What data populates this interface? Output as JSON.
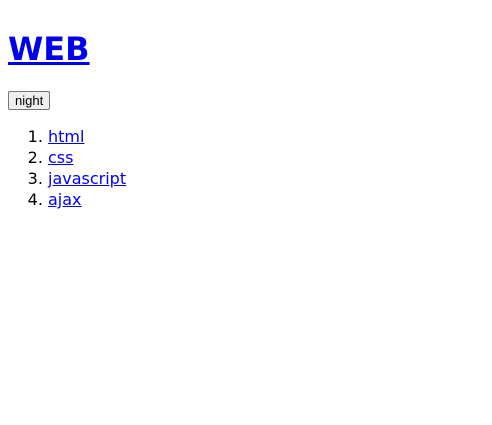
{
  "page": {
    "title": "WEB"
  },
  "toolbar": {
    "night_label": "night"
  },
  "nav": {
    "items": [
      {
        "label": "html"
      },
      {
        "label": "css"
      },
      {
        "label": "javascript"
      },
      {
        "label": "ajax"
      }
    ]
  },
  "colors": {
    "link": "#0000ee",
    "background": "#ffffff",
    "text": "#000000",
    "button_bg": "#efefef",
    "button_border": "#767676"
  }
}
